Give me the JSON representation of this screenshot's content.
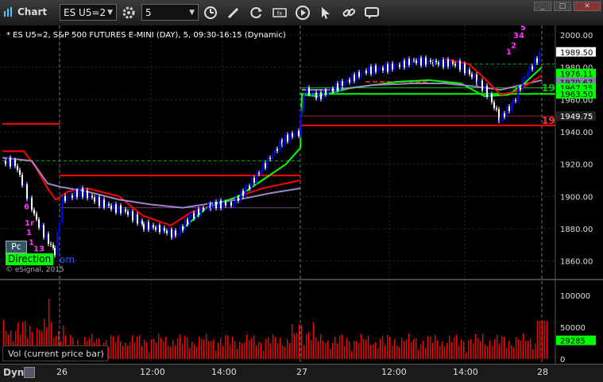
{
  "window": {
    "title": "Chart"
  },
  "toolbar": {
    "symbol": "ES U5=2",
    "interval": "5",
    "icons": [
      "interval-settings-icon",
      "draw-tool-icon",
      "refresh-icon",
      "studies-icon",
      "play-icon",
      "cursor-icon",
      "link-icon",
      "chat-icon"
    ]
  },
  "chart": {
    "title": "* ES U5=2, S&P 500 FUTURES E-MINI (DAY), 5, 09:30-16:15 (Dynamic)",
    "price_labels": [
      {
        "text": "1989.50",
        "bg": "#ffffff",
        "fg": "#000000"
      },
      {
        "text": "1976.11",
        "bg": "#00ff00",
        "fg": "#000000"
      },
      {
        "text": "1970.67",
        "bg": "#8a7ab5",
        "fg": "#000000"
      },
      {
        "text": "1967.25",
        "bg": "#00ff00",
        "fg": "#000000"
      },
      {
        "text": "1963.50",
        "bg": "#00ff00",
        "fg": "#000000"
      },
      {
        "text": "1949.75",
        "bg": "#222222",
        "fg": "#ffffff"
      }
    ],
    "axis_ticks": [
      "2000.00",
      "1980.00",
      "1960.00",
      "1940.00",
      "1920.00",
      "1900.00",
      "1880.00",
      "1860.00"
    ],
    "tags": [
      "19",
      "19"
    ],
    "pc_label": "Pc",
    "direction_label": "Direction",
    "direction_tail": "om",
    "copyright": "© eSignal, 2015",
    "volume": {
      "label": "Vol (current price bar)",
      "ticks": [
        "100000",
        "50000",
        "0"
      ],
      "current": "29285"
    },
    "colors": {
      "up": "#0000ff",
      "down": "#ffffff",
      "ma_red": "#ff0000",
      "ma_green": "#00ff00",
      "ma_purple": "#9d86c7",
      "volume": "#ff0000"
    }
  },
  "time_axis": {
    "labels": [
      "26",
      "12:00",
      "14:00",
      "27",
      "12:00",
      "14:00",
      "28"
    ]
  },
  "bottom_bar": {
    "dyn_label": "Dyn"
  }
}
